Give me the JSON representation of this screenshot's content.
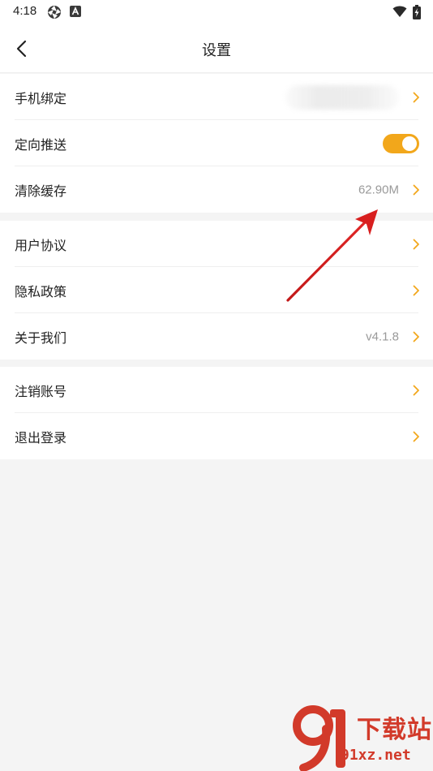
{
  "status_bar": {
    "time": "4:18",
    "left_icons": [
      "aperture-icon",
      "font-a-icon"
    ],
    "right_icons": [
      "wifi-icon",
      "battery-charging-icon"
    ]
  },
  "header": {
    "title": "设置",
    "back_icon": "chevron-left-icon"
  },
  "accent_color": "#f2a71b",
  "groups": [
    {
      "rows": [
        {
          "label": "手机绑定",
          "value": "",
          "value_blurred": true,
          "control": "chevron"
        },
        {
          "label": "定向推送",
          "control": "toggle",
          "toggle_on": true
        },
        {
          "label": "清除缓存",
          "value": "62.90M",
          "control": "chevron"
        }
      ]
    },
    {
      "rows": [
        {
          "label": "用户协议",
          "control": "chevron"
        },
        {
          "label": "隐私政策",
          "control": "chevron"
        },
        {
          "label": "关于我们",
          "value": "v4.1.8",
          "control": "chevron"
        }
      ]
    },
    {
      "rows": [
        {
          "label": "注销账号",
          "control": "chevron"
        },
        {
          "label": "退出登录",
          "control": "chevron"
        }
      ]
    }
  ],
  "watermark": {
    "title": "下载站",
    "domain": "91xz.net"
  }
}
